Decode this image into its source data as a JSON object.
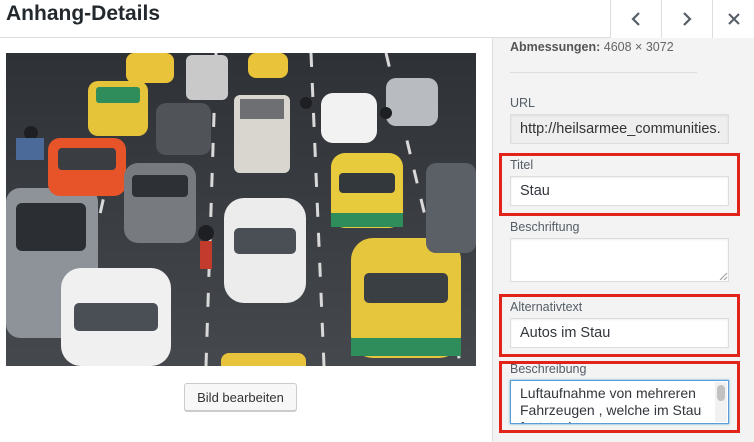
{
  "header": {
    "title": "Anhang-Details",
    "prev_icon": "chevron-left-icon",
    "next_icon": "chevron-right-icon",
    "close_icon": "close-icon",
    "prev_glyph": "‹",
    "next_glyph": "›",
    "close_glyph": "✕"
  },
  "media": {
    "edit_button_label": "Bild bearbeiten"
  },
  "details": {
    "dimensions_label": "Abmessungen:",
    "dimensions_value": "4608 × 3072",
    "url_label": "URL",
    "url_value": "http://heilsarmee_communities.",
    "title_label": "Titel",
    "title_value": "Stau",
    "caption_label": "Beschriftung",
    "caption_value": "",
    "alt_label": "Alternativtext",
    "alt_value": "Autos im Stau",
    "description_label": "Beschreibung",
    "description_value": "Luftaufnahme von mehreren Fahrzeugen , welche im Stau feststecken"
  },
  "colors": {
    "highlight": "#e2231a",
    "focus_border": "#5b9dd9"
  }
}
